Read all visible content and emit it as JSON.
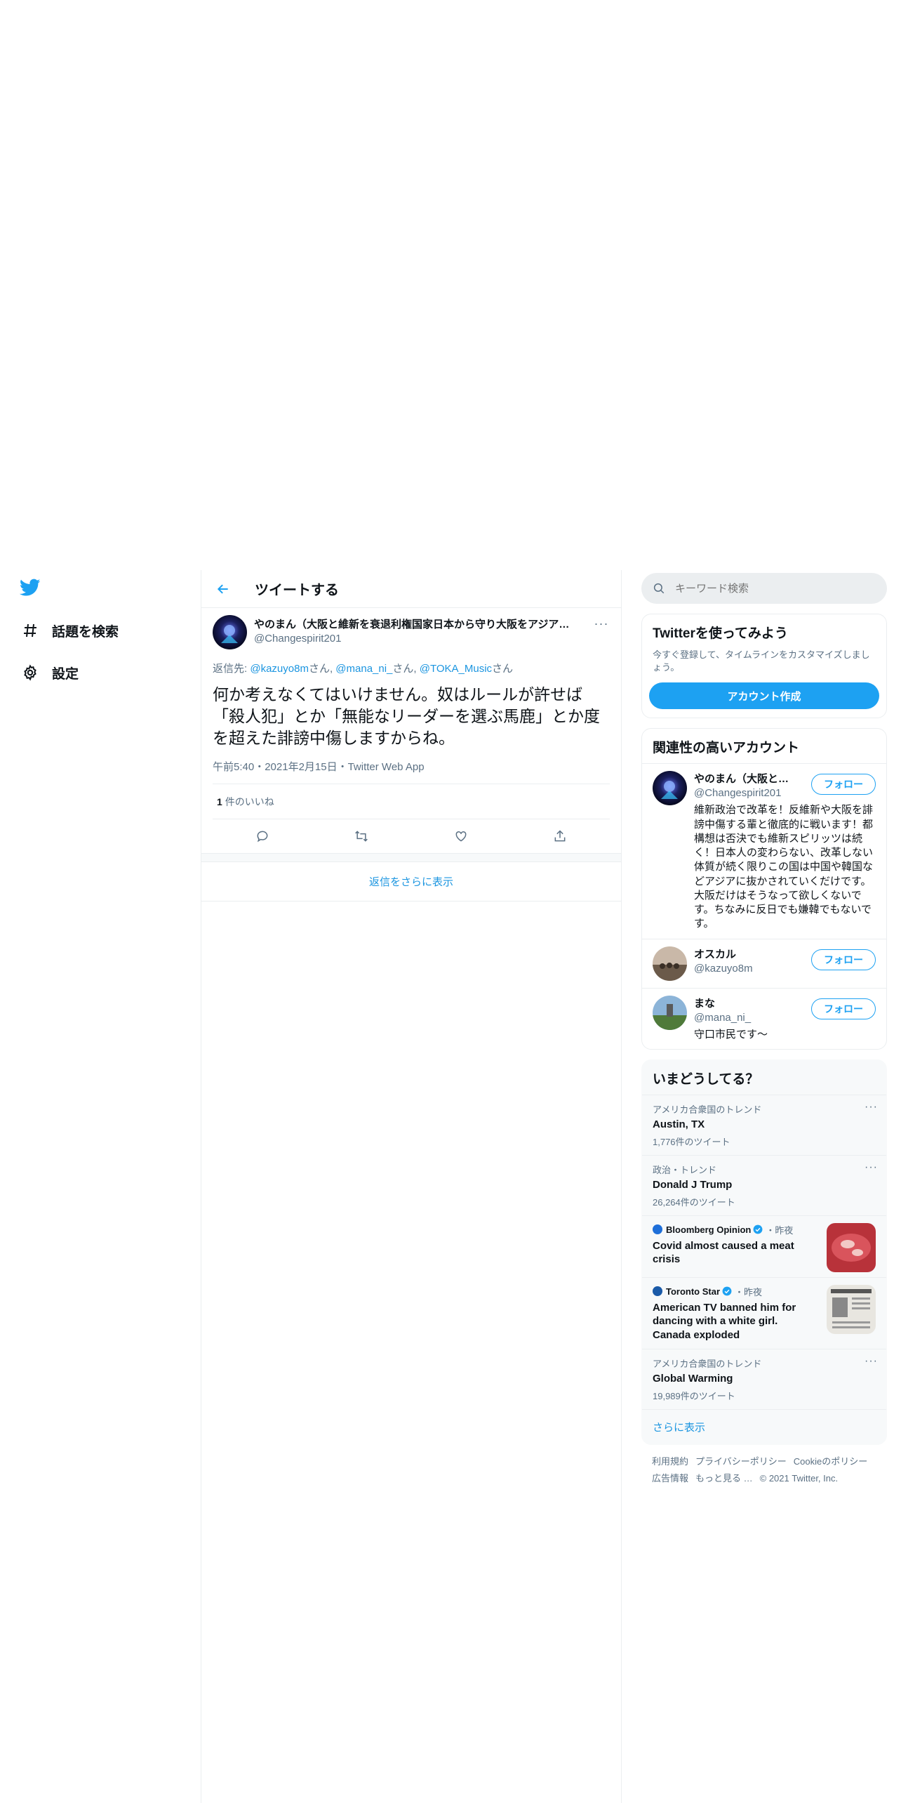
{
  "nav": {
    "items": [
      {
        "label": "話題を検索",
        "icon": "hashtag-icon"
      },
      {
        "label": "設定",
        "icon": "gear-icon"
      }
    ]
  },
  "header": {
    "title": "ツイートする"
  },
  "tweet": {
    "author_name": "やのまん（大阪と維新を衰退利権国家日本から守り大阪をアジアの…",
    "author_handle": "@Changespirit201",
    "reply_prefix": "返信先: ",
    "reply_users": [
      {
        "handle": "@kazuyo8m",
        "suffix": "さん, "
      },
      {
        "handle": "@mana_ni_",
        "suffix": "さん, "
      },
      {
        "handle": "@TOKA_Music",
        "suffix": "さん"
      }
    ],
    "text": "何か考えなくてはいけません。奴はルールが許せば「殺人犯」とか「無能なリーダーを選ぶ馬鹿」とか度を超えた誹謗中傷しますからね。",
    "meta": "午前5:40・2021年2月15日・Twitter Web App",
    "likes_count": "1",
    "likes_label": "件のいいね",
    "more_replies": "返信をさらに表示"
  },
  "search": {
    "placeholder": "キーワード検索"
  },
  "signup": {
    "title": "Twitterを使ってみよう",
    "desc": "今すぐ登録して、タイムラインをカスタマイズしましょう。",
    "button": "アカウント作成"
  },
  "related": {
    "title": "関連性の高いアカウント",
    "follow_label": "フォロー",
    "accounts": [
      {
        "name": "やのまん（大阪と維新を衰退利権国家日本から守り大阪をアジアの…",
        "handle": "@Changespirit201",
        "bio": "維新政治で改革を！反維新や大阪を誹謗中傷する輩と徹底的に戦います！都構想は否決でも維新スピリッツは続く！日本人の変わらない、改革しない体質が続く限りこの国は中国や韓国などアジアに抜かされていくだけです。大阪だけはそうなって欲しくないです。ちなみに反日でも嫌韓でもないです。"
      },
      {
        "name": "オスカル",
        "handle": "@kazuyo8m",
        "bio": ""
      },
      {
        "name": "まな",
        "handle": "@mana_ni_",
        "bio": "守口市民です〜"
      }
    ]
  },
  "trends": {
    "title": "いまどうしてる？",
    "items": [
      {
        "context": "アメリカ合衆国のトレンド",
        "name": "Austin, TX",
        "count": "1,776件のツイート"
      },
      {
        "context": "政治・トレンド",
        "name": "Donald J Trump",
        "count": "26,264件のツイート"
      }
    ],
    "news": [
      {
        "source": "Bloomberg Opinion",
        "time": "・昨夜",
        "title": "Covid almost caused a meat crisis"
      },
      {
        "source": "Toronto Star",
        "time": "・昨夜",
        "title": "American TV banned him for dancing with a white girl. Canada exploded"
      }
    ],
    "last": {
      "context": "アメリカ合衆国のトレンド",
      "name": "Global Warming",
      "count": "19,989件のツイート"
    },
    "show_more": "さらに表示"
  },
  "footer": {
    "links": [
      "利用規約",
      "プライバシーポリシー",
      "Cookieのポリシー",
      "広告情報",
      "もっと見る …"
    ],
    "copyright": "© 2021 Twitter, Inc."
  },
  "colors": {
    "accent": "#1da1f2",
    "link": "#1b95e0",
    "muted": "#5b7083"
  }
}
